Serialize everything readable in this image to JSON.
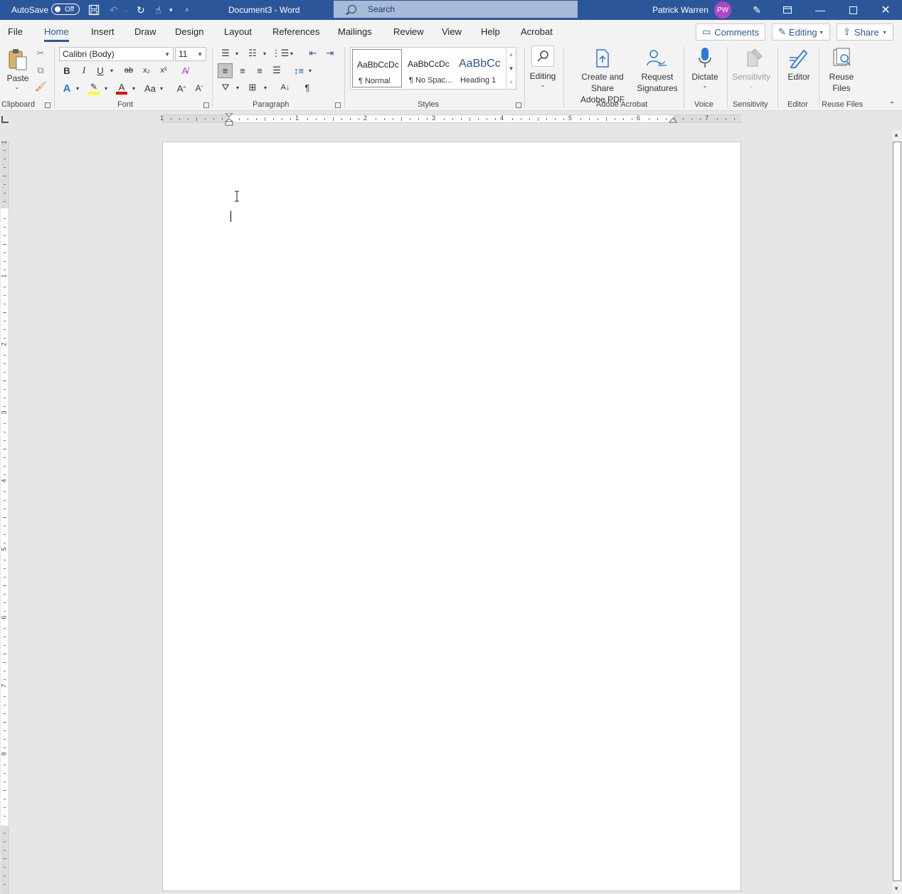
{
  "titlebar": {
    "autosave_label": "AutoSave",
    "autosave_state": "Off",
    "doc_title": "Document3  -  Word",
    "search_placeholder": "Search",
    "user_name": "Patrick Warren",
    "user_initials": "PW"
  },
  "tabs": [
    {
      "label": "File"
    },
    {
      "label": "Home"
    },
    {
      "label": "Insert"
    },
    {
      "label": "Draw"
    },
    {
      "label": "Design"
    },
    {
      "label": "Layout"
    },
    {
      "label": "References"
    },
    {
      "label": "Mailings"
    },
    {
      "label": "Review"
    },
    {
      "label": "View"
    },
    {
      "label": "Help"
    },
    {
      "label": "Acrobat"
    }
  ],
  "tab_buttons": {
    "comments": "Comments",
    "editing": "Editing",
    "share": "Share"
  },
  "ribbon": {
    "clipboard": {
      "paste": "Paste",
      "label": "Clipboard"
    },
    "font": {
      "name": "Calibri (Body)",
      "size": "11",
      "label": "Font"
    },
    "paragraph": {
      "label": "Paragraph"
    },
    "styles": {
      "label": "Styles",
      "items": [
        {
          "sample": "AaBbCcDc",
          "name": "¶ Normal"
        },
        {
          "sample": "AaBbCcDc",
          "name": "¶ No Spac..."
        },
        {
          "sample": "AaBbCc",
          "name": "Heading 1"
        }
      ]
    },
    "editing": {
      "label": "Editing"
    },
    "acrobat": {
      "create": "Create and Share",
      "create2": "Adobe PDF",
      "request": "Request",
      "request2": "Signatures",
      "label": "Adobe Acrobat"
    },
    "voice": {
      "dictate": "Dictate",
      "label": "Voice"
    },
    "sensitivity": {
      "btn": "Sensitivity",
      "label": "Sensitivity"
    },
    "editor": {
      "btn": "Editor",
      "label": "Editor"
    },
    "reuse": {
      "btn": "Reuse",
      "btn2": "Files",
      "label": "Reuse Files"
    }
  },
  "ruler": {
    "h_numbers": [
      "1",
      "1",
      "2",
      "3",
      "4",
      "5",
      "6",
      "7"
    ],
    "v_numbers": [
      "1",
      "1",
      "2",
      "3",
      "4",
      "5",
      "6",
      "7",
      "8"
    ]
  },
  "colors": {
    "brand": "#2b579a",
    "avatar": "#b146c2",
    "highlight": "#ffff00",
    "font_color": "#e00000"
  }
}
